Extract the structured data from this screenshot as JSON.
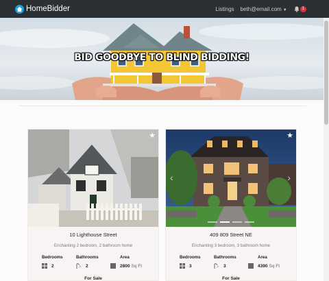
{
  "navbar": {
    "brand": "HomeBidder",
    "links": {
      "listings": "Listings",
      "user_email": "beth@email.com"
    },
    "notification_count": "1"
  },
  "hero": {
    "title": "BID GOODBYE TO BLIND BIDDING!"
  },
  "listings": [
    {
      "address": "10 Lighthouse Street",
      "description": "Enchanting 2 bedroom, 2 bathroom home",
      "bedrooms_label": "Bedrooms",
      "bedrooms": "2",
      "bathrooms_label": "Bathrooms",
      "bathrooms": "2",
      "area_label": "Area",
      "area": "2800",
      "area_unit": "Sq Ft",
      "status": "For Sale"
    },
    {
      "address": "409 809 Street NE",
      "description": "Enchanting 3 bedroom, 3 bathroom home",
      "bedrooms_label": "Bedrooms",
      "bedrooms": "3",
      "bathrooms_label": "Bathrooms",
      "bathrooms": "3",
      "area_label": "Area",
      "area": "4390",
      "area_unit": "Sq Ft",
      "status": "For Sale"
    }
  ],
  "icons": {
    "brand": "house-logo-icon",
    "bell": "bell-icon",
    "star": "star-icon",
    "bedrooms": "bed-grid-icon",
    "bathrooms": "shower-icon",
    "area": "area-square-icon"
  },
  "colors": {
    "navbar": "#2b3034",
    "brand_accent": "#1ba1e0",
    "badge": "#d9363e"
  }
}
